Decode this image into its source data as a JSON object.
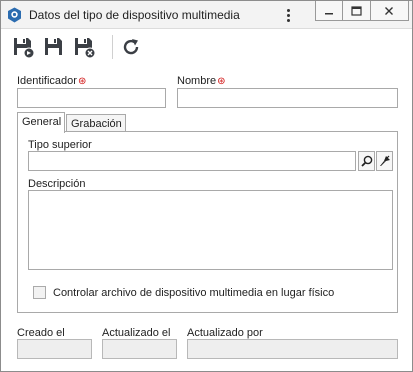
{
  "window": {
    "title": "Datos del tipo de dispositivo multimedia",
    "app_icon": "app-icon",
    "controls": [
      "minimize-icon",
      "maximize-icon",
      "close-icon"
    ]
  },
  "toolbar": {
    "buttons": [
      "save-and-new-icon",
      "save-icon",
      "save-and-close-icon",
      "refresh-icon"
    ]
  },
  "form": {
    "identifier_label": "Identificador",
    "identifier_value": "",
    "name_label": "Nombre",
    "name_value": "",
    "required_color": "#d11111"
  },
  "tabs": {
    "items": [
      "General",
      "Grabación"
    ],
    "active": "General"
  },
  "general": {
    "parent_type_label": "Tipo superior",
    "parent_type_value": "",
    "description_label": "Descripción",
    "description_value": "",
    "checkbox_label": "Controlar archivo de dispositivo multimedia en lugar físico",
    "checkbox_checked": false
  },
  "footer": {
    "created_label": "Creado el",
    "created_value": "",
    "updated_label": "Actualizado el",
    "updated_value": "",
    "updated_by_label": "Actualizado por",
    "updated_by_value": ""
  }
}
